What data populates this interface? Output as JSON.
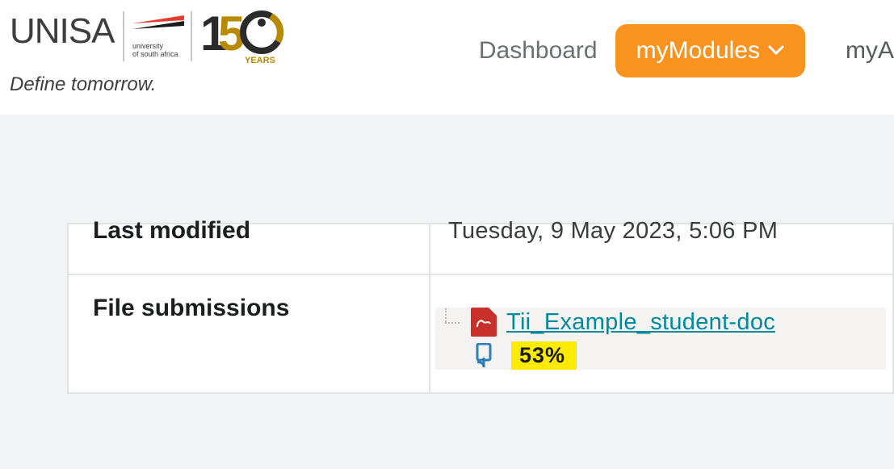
{
  "header": {
    "brand_text": "UNISA",
    "tagline": "Define tomorrow.",
    "sublogo_line1": "university",
    "sublogo_line2": "of south africa",
    "anniversary_years": "YEARS",
    "nav": {
      "dashboard": "Dashboard",
      "mymodules": "myModules",
      "right_partial": "myA"
    }
  },
  "table": {
    "row1": {
      "label": "Last modified",
      "value": "Tuesday, 9 May 2023, 5:06 PM"
    },
    "row2": {
      "label": "File submissions",
      "file_name": "Tii_Example_student-doc",
      "similarity_score": "53%"
    }
  }
}
